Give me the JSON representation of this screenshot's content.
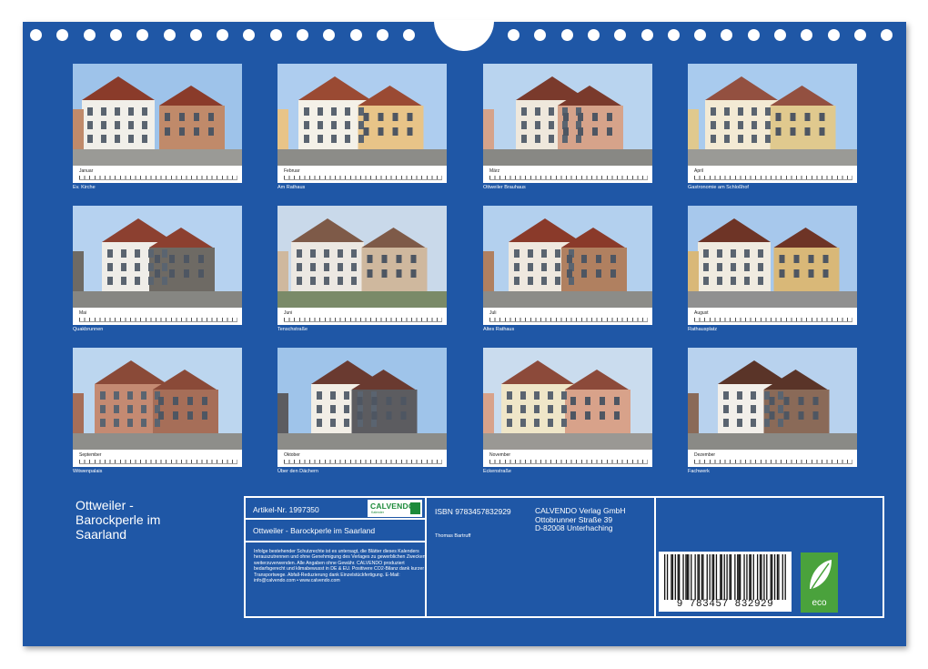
{
  "calendar": {
    "title": "Ottweiler - Barockperle im Saarland",
    "title_lines": [
      "Ottweiler -",
      "Barockperle im",
      "Saarland"
    ],
    "background_color": "#1f57a6"
  },
  "months": [
    {
      "name": "Januar",
      "caption": "Ev. Kirche"
    },
    {
      "name": "Februar",
      "caption": "Am Rathaus"
    },
    {
      "name": "März",
      "caption": "Ottweiler Brauhaus"
    },
    {
      "name": "April",
      "caption": "Gastronomie am Schloßhof"
    },
    {
      "name": "Mai",
      "caption": "Quakbrunnen"
    },
    {
      "name": "Juni",
      "caption": "Tenschstraße"
    },
    {
      "name": "Juli",
      "caption": "Altes Rathaus"
    },
    {
      "name": "August",
      "caption": "Rathausplatz"
    },
    {
      "name": "September",
      "caption": "Witwenpalais"
    },
    {
      "name": "Oktober",
      "caption": "Über den Dächern"
    },
    {
      "name": "November",
      "caption": "Eckenstraße"
    },
    {
      "name": "Dezember",
      "caption": "Fachwerk"
    }
  ],
  "info": {
    "article": "Artikel-Nr. 1997350",
    "logo": "CALVENDO",
    "logo_sub": "Kalender",
    "product_title": "Ottweiler - Barockperle im Saarland",
    "legal_text": "Infolge bestehender Schutzrechte ist es untersagt, die Blätter dieses Kalenders herauszutrennen und ohne Genehmigung des Verlages zu gewerblichen Zwecken weiterzuverwenden. Alle Angaben ohne Gewähr. CALVENDO produziert bedarfsgerecht und klimabewusst in DE & EU. Positivere CO2-Bilanz dank kurzer Transportwege. Abfall-Reduzierung dank Einzelstückfertigung. E-Mail: info@calvendo.com • www.calvendo.com",
    "isbn": "ISBN 9783457832929",
    "author": "Thomas Bartruff",
    "publisher": [
      "CALVENDO Verlag GmbH",
      "Ottobrunner Straße 39",
      "D-82008 Unterhaching"
    ],
    "barcode_number": "9 783457 832929",
    "eco_label": "eco"
  }
}
